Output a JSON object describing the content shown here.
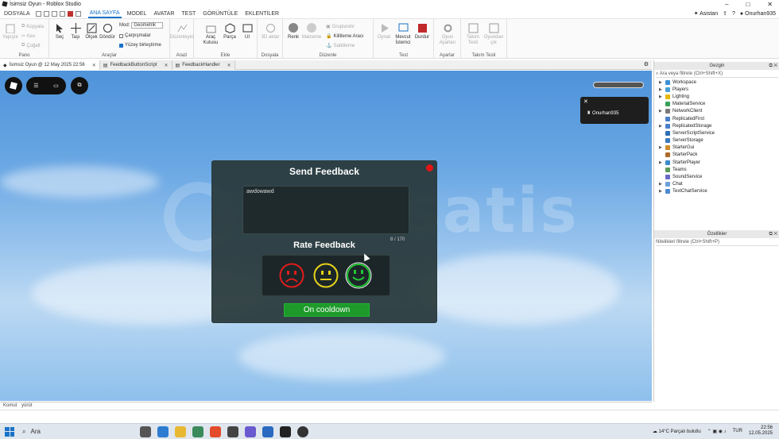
{
  "window": {
    "title": "İsimsiz Oyun - Roblox Studio",
    "controls": [
      "–",
      "□",
      "✕"
    ]
  },
  "menu": {
    "tabs": [
      "DOSYALA",
      "ANA SAYFA",
      "MODEL",
      "AVATAR",
      "TEST",
      "GÖRÜNTÜLE",
      "EKLENTİLER"
    ],
    "active": "ANA SAYFA",
    "assistant": "Asistan",
    "user": "Onurhan935"
  },
  "ribbon": {
    "groups": [
      "Pano",
      "Araçlar",
      "Arazi",
      "Ekle",
      "Dosyala",
      "Düzenle",
      "Test",
      "Ayarlar",
      "Takım Testi"
    ],
    "pano": {
      "paste": "Yapıştır",
      "copy": "Kopyala",
      "cut": "Kes",
      "duplicate": "Çoğalt"
    },
    "tools": {
      "select": "Seç",
      "move": "Taşı",
      "scale": "Ölçek",
      "rotate": "Döndür",
      "mode_label": "Mod:",
      "mode_value": "Geometrik",
      "collisions": "Çarpışmalar",
      "join": "Yüzey birleştirme"
    },
    "terrain": {
      "editor": "Düzenleyici"
    },
    "insert": {
      "toolbox": "Araç Kutusu",
      "part": "Parça",
      "ui": "UI"
    },
    "file": {
      "import3d": "3D aktar"
    },
    "edit": {
      "color": "Renk",
      "material": "Malzeme",
      "group": "Gruplandır",
      "lock": "Kilitleme Aracı",
      "anchor": "Sabitleme"
    },
    "test": {
      "play": "Oynat",
      "current_client": "Mevcut İstemci",
      "stop": "Durdur"
    },
    "settings": {
      "game_settings": "Oyun Ayarları"
    },
    "team": {
      "team_test": "Takım Testi",
      "exit_game": "Oyundan çık"
    }
  },
  "doc_tabs": [
    {
      "label": "İsimsiz Oyun @ 12 May 2025 22:56",
      "active": true
    },
    {
      "label": "FeedbackButtonScript",
      "active": false
    },
    {
      "label": "FeedbackHandler",
      "active": false
    }
  ],
  "game": {
    "player_name": "Onurhan935",
    "watermark": "itemsatis",
    "feedback": {
      "title": "Send Feedback",
      "input_text": "awdowawd",
      "char_count": "8 / 170",
      "rate_title": "Rate Feedback",
      "faces": [
        {
          "name": "sad",
          "color": "#e01c1c"
        },
        {
          "name": "neutral",
          "color": "#e6d21a"
        },
        {
          "name": "happy",
          "color": "#22c834",
          "selected": true
        }
      ],
      "cooldown_label": "On cooldown"
    }
  },
  "explorer": {
    "title": "Gezgin",
    "filter": "Ara veya filtrele (Ctrl+Shift+X)",
    "items": [
      {
        "label": "Workspace",
        "color": "#3c8fd6",
        "expandable": true
      },
      {
        "label": "Players",
        "color": "#4aa0d8",
        "expandable": true
      },
      {
        "label": "Lighting",
        "color": "#e6b800",
        "expandable": true
      },
      {
        "label": "MaterialService",
        "color": "#3aa05a",
        "expandable": false
      },
      {
        "label": "NetworkClient",
        "color": "#7a7a7a",
        "expandable": true
      },
      {
        "label": "ReplicatedFirst",
        "color": "#4a80c8",
        "expandable": false
      },
      {
        "label": "ReplicatedStorage",
        "color": "#4a80c8",
        "expandable": true
      },
      {
        "label": "ServerScriptService",
        "color": "#2f6fb5",
        "expandable": false
      },
      {
        "label": "ServerStorage",
        "color": "#3a7ac0",
        "expandable": false
      },
      {
        "label": "StarterGui",
        "color": "#d08a2a",
        "expandable": true
      },
      {
        "label": "StarterPack",
        "color": "#b06a2a",
        "expandable": false
      },
      {
        "label": "StarterPlayer",
        "color": "#3a8acb",
        "expandable": true
      },
      {
        "label": "Teams",
        "color": "#5a9a5a",
        "expandable": false
      },
      {
        "label": "SoundService",
        "color": "#6a6ac8",
        "expandable": false
      },
      {
        "label": "Chat",
        "color": "#6aa0d8",
        "expandable": true
      },
      {
        "label": "TextChatService",
        "color": "#4a8ad0",
        "expandable": true
      }
    ]
  },
  "properties": {
    "title": "Özellikler",
    "filter": "Nitelikleri filtrele (Ctrl+Shift+P)"
  },
  "command": {
    "label": "Komut",
    "value": "yürüt"
  },
  "taskbar": {
    "search": "Ara",
    "weather": "14°C  Parçalı bulutlu",
    "lang": "TUR",
    "time": "22:56",
    "date": "12.05.2025"
  }
}
